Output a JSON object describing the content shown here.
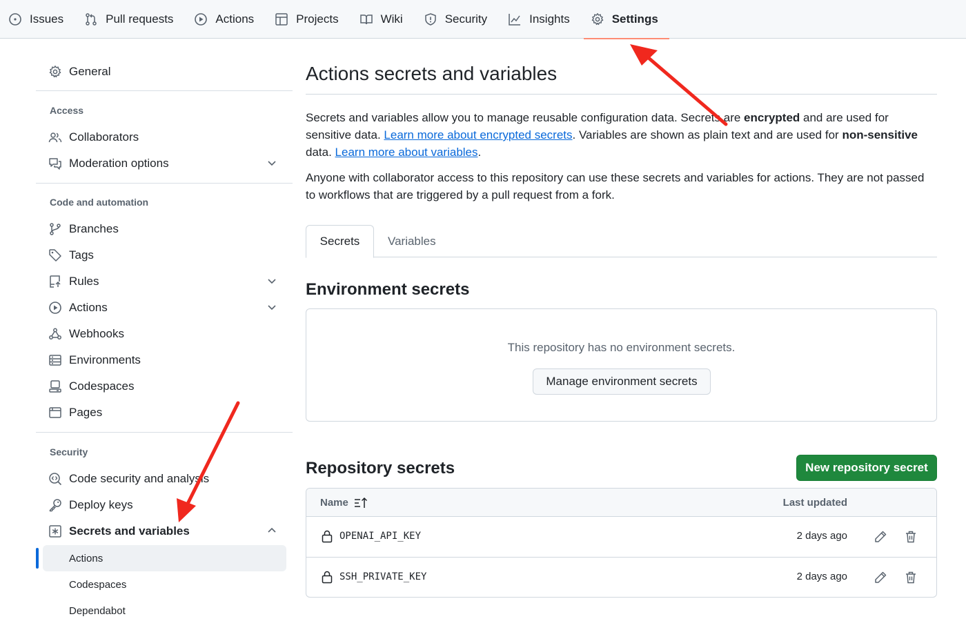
{
  "topnav": {
    "items": [
      {
        "label": "Issues",
        "icon": "issue-opened-icon"
      },
      {
        "label": "Pull requests",
        "icon": "git-pull-request-icon"
      },
      {
        "label": "Actions",
        "icon": "play-icon"
      },
      {
        "label": "Projects",
        "icon": "table-icon"
      },
      {
        "label": "Wiki",
        "icon": "book-icon"
      },
      {
        "label": "Security",
        "icon": "shield-icon"
      },
      {
        "label": "Insights",
        "icon": "graph-icon"
      },
      {
        "label": "Settings",
        "icon": "gear-icon",
        "active": true
      }
    ]
  },
  "sidebar": {
    "general": "General",
    "access_heading": "Access",
    "collaborators": "Collaborators",
    "moderation": "Moderation options",
    "code_heading": "Code and automation",
    "branches": "Branches",
    "tags": "Tags",
    "rules": "Rules",
    "actions": "Actions",
    "webhooks": "Webhooks",
    "environments": "Environments",
    "codespaces": "Codespaces",
    "pages": "Pages",
    "security_heading": "Security",
    "code_security": "Code security and analysis",
    "deploy_keys": "Deploy keys",
    "secrets_vars": "Secrets and variables",
    "sub_actions": "Actions",
    "sub_codespaces": "Codespaces",
    "sub_dependabot": "Dependabot"
  },
  "main": {
    "title": "Actions secrets and variables",
    "intro": {
      "p1": "Secrets and variables allow you to manage reusable configuration data. Secrets are ",
      "p1_bold": "encrypted",
      "p2": " and are used for sensitive data. ",
      "link1": "Learn more about encrypted secrets",
      "p3": ". Variables are shown as plain text and are used for ",
      "p3_bold": "non-sensitive",
      "p4": " data. ",
      "link2": "Learn more about variables",
      "p5": "."
    },
    "notice": "Anyone with collaborator access to this repository can use these secrets and variables for actions. They are not passed to workflows that are triggered by a pull request from a fork.",
    "tabs": {
      "secrets": "Secrets",
      "variables": "Variables"
    },
    "env": {
      "heading": "Environment secrets",
      "empty": "This repository has no environment secrets.",
      "manage_button": "Manage environment secrets"
    },
    "repo": {
      "heading": "Repository secrets",
      "new_button": "New repository secret",
      "col_name": "Name",
      "col_updated": "Last updated",
      "rows": [
        {
          "name": "OPENAI_API_KEY",
          "updated": "2 days ago"
        },
        {
          "name": "SSH_PRIVATE_KEY",
          "updated": "2 days ago"
        }
      ]
    }
  },
  "annotations": {
    "arrow_color": "#f0281e"
  }
}
